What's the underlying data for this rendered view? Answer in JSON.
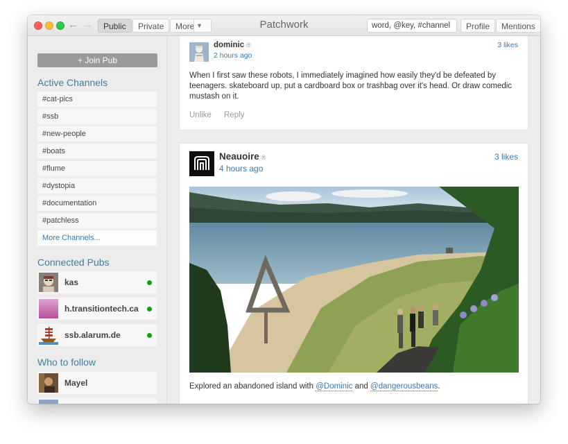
{
  "window": {
    "title": "Patchwork",
    "tabs": [
      "Public",
      "Private",
      "More"
    ],
    "search_value": "word, @key, #channel",
    "right_buttons": [
      "Profile",
      "Mentions"
    ]
  },
  "sidebar": {
    "join_label": "+ Join Pub",
    "channels_heading": "Active Channels",
    "channels": [
      "#cat-pics",
      "#ssb",
      "#new-people",
      "#boats",
      "#flume",
      "#dystopia",
      "#documentation",
      "#patchless"
    ],
    "more_channels": "More Channels...",
    "pubs_heading": "Connected Pubs",
    "pubs": [
      {
        "name": "kas",
        "online": true
      },
      {
        "name": "h.transitiontech.ca",
        "online": true
      },
      {
        "name": "ssb.alarum.de",
        "online": true
      }
    ],
    "follow_heading": "Who to follow",
    "follow": [
      {
        "name": "Mayel"
      }
    ]
  },
  "posts": [
    {
      "author": "dominic",
      "verified_mark": "®",
      "time": "2 hours ago",
      "likes": "3 likes",
      "text": "When I first saw these robots, I immediately imagined how easily they'd be defeated by teenagers. skateboard up, put a cardboard box or trashbag over it's head. Or draw comedic mustash on it.",
      "actions": [
        "Unlike",
        "Reply"
      ]
    },
    {
      "author": "Neauoire",
      "verified_mark": "®",
      "time": "4 hours ago",
      "likes": "3 likes",
      "text_before": "Explored an abandoned island with ",
      "mention1": "@Dominic",
      "text_mid": " and ",
      "mention2": "@dangerousbeans",
      "text_after": "."
    }
  ],
  "colors": {
    "accent": "#3a7ab0",
    "heading": "#3f7f9e",
    "online": "#13a10e"
  }
}
